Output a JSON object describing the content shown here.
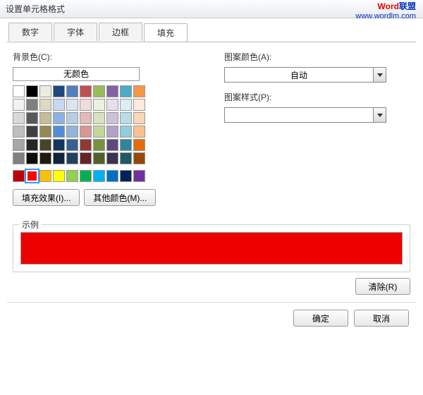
{
  "window": {
    "title": "设置单元格格式"
  },
  "watermark": {
    "brand_a": "Word",
    "brand_b": "联盟",
    "url": "www.wordlm.com"
  },
  "tabs": [
    {
      "label": "数字",
      "active": false
    },
    {
      "label": "字体",
      "active": false
    },
    {
      "label": "边框",
      "active": false
    },
    {
      "label": "填充",
      "active": true
    }
  ],
  "fill": {
    "bg_label": "背景色(C):",
    "no_color": "无颜色",
    "effects_btn": "填充效果(I)...",
    "more_colors_btn": "其他颜色(M)...",
    "pattern_color_label": "图案颜色(A):",
    "pattern_color_value": "自动",
    "pattern_style_label": "图案样式(P):",
    "pattern_style_value": ""
  },
  "palette": {
    "theme": [
      [
        "#ffffff",
        "#000000",
        "#eeece1",
        "#1f497d",
        "#4f81bd",
        "#c0504d",
        "#9bbb59",
        "#8064a2",
        "#4bacc6",
        "#f79646"
      ],
      [
        "#f2f2f2",
        "#808080",
        "#ddd9c3",
        "#c6d9f0",
        "#dce6f1",
        "#f2dcdb",
        "#ebf1dd",
        "#e5e0ec",
        "#dbeef3",
        "#fdeada"
      ],
      [
        "#d9d9d9",
        "#595959",
        "#c4bd97",
        "#8db3e2",
        "#b8cce4",
        "#e5b9b7",
        "#d7e3bc",
        "#ccc1d9",
        "#b7dde8",
        "#fbd5b5"
      ],
      [
        "#bfbfbf",
        "#404040",
        "#938953",
        "#548dd4",
        "#95b3d7",
        "#d99694",
        "#c3d69b",
        "#b2a2c7",
        "#92cddc",
        "#fac08f"
      ],
      [
        "#a6a6a6",
        "#262626",
        "#494429",
        "#17365d",
        "#366092",
        "#953734",
        "#76923c",
        "#5f497a",
        "#31859b",
        "#e36c09"
      ],
      [
        "#808080",
        "#0d0d0d",
        "#1d1b10",
        "#0f243e",
        "#244061",
        "#632423",
        "#4f6128",
        "#3f3151",
        "#205867",
        "#974806"
      ]
    ],
    "standard": [
      "#c00000",
      "#ff0000",
      "#ffc000",
      "#ffff00",
      "#92d050",
      "#00b050",
      "#00b0f0",
      "#0070c0",
      "#002060",
      "#7030a0"
    ],
    "selected": "#ff0000"
  },
  "sample": {
    "label": "示例",
    "color": "#ed0000"
  },
  "buttons": {
    "clear": "清除(R)",
    "ok": "确定",
    "cancel": "取消"
  }
}
